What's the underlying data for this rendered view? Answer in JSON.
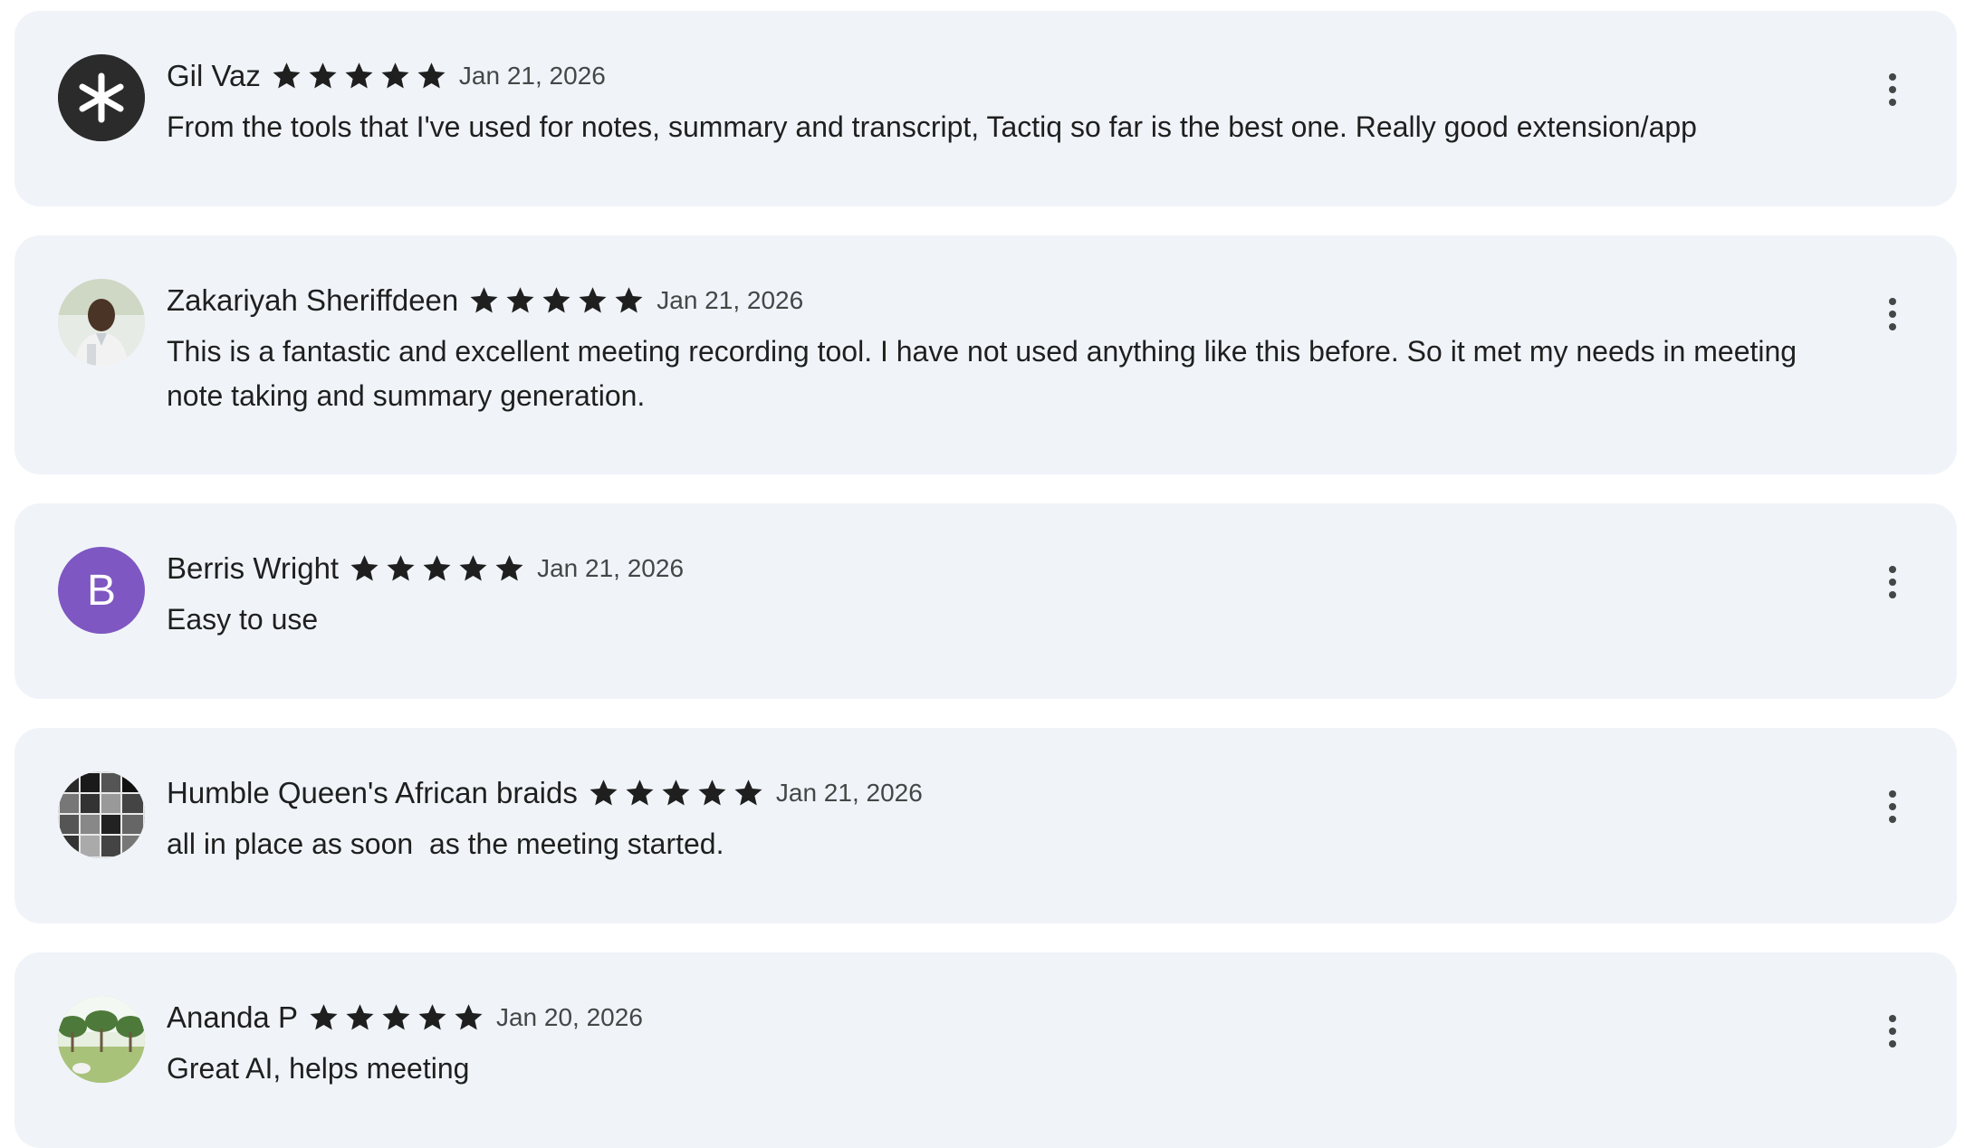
{
  "colors": {
    "card_background": "#f0f4f9",
    "star": "#1f1f1f",
    "text_primary": "#1f1f1f",
    "text_secondary": "#444746",
    "avatar_purple": "#7e57c2",
    "avatar_dark": "#2b2b2b"
  },
  "reviews": [
    {
      "reviewer": "Gil Vaz",
      "avatar": "asterisk-logo-icon",
      "rating": 5,
      "date": "Jan 21, 2026",
      "text": "From the tools that I've used for notes, summary and transcript, Tactiq so far is the best one. Really good extension/app",
      "menu_icon": "more-vert-icon"
    },
    {
      "reviewer": "Zakariyah Sheriffdeen",
      "avatar": "profile-photo",
      "rating": 5,
      "date": "Jan 21, 2026",
      "text": "This is a fantastic and excellent meeting recording tool. I have not used anything like this before. So it met my needs in meeting note taking and summary generation.",
      "menu_icon": "more-vert-icon"
    },
    {
      "reviewer": "Berris Wright",
      "avatar_letter": "B",
      "rating": 5,
      "date": "Jan 21, 2026",
      "text": "Easy to use",
      "menu_icon": "more-vert-icon"
    },
    {
      "reviewer": "Humble Queen's African braids",
      "avatar": "collage-photo",
      "rating": 5,
      "date": "Jan 21, 2026",
      "text": "all in place as soon  as the meeting started.",
      "menu_icon": "more-vert-icon"
    },
    {
      "reviewer": "Ananda P",
      "avatar": "landscape-photo",
      "rating": 5,
      "date": "Jan 20, 2026",
      "text": "Great AI, helps meeting",
      "menu_icon": "more-vert-icon"
    }
  ]
}
